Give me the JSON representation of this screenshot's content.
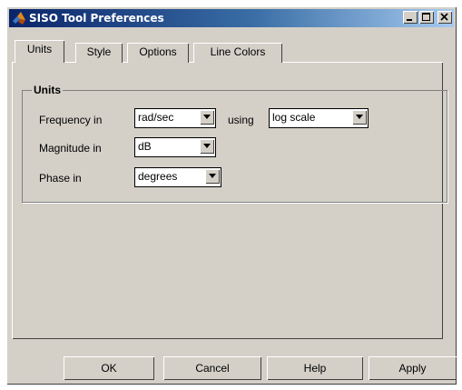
{
  "window": {
    "title": "SISO Tool Preferences",
    "controls": {
      "minimize": "minimize-icon",
      "maximize": "maximize-icon",
      "close": "close-icon"
    }
  },
  "tabs": [
    {
      "label": "Units",
      "active": true
    },
    {
      "label": "Style",
      "active": false
    },
    {
      "label": "Options",
      "active": false
    },
    {
      "label": "Line Colors",
      "active": false
    }
  ],
  "units_group": {
    "title": "Units",
    "frequency": {
      "label": "Frequency in",
      "value": "rad/sec",
      "using_label": "using",
      "scale_value": "log scale"
    },
    "magnitude": {
      "label": "Magnitude in",
      "value": "dB"
    },
    "phase": {
      "label": "Phase in",
      "value": "degrees"
    }
  },
  "buttons": {
    "ok": "OK",
    "cancel": "Cancel",
    "help": "Help",
    "apply": "Apply"
  },
  "colors": {
    "dialog_bg": "#d4d0c8",
    "title_start": "#0a246a",
    "title_end": "#a6caf0"
  }
}
